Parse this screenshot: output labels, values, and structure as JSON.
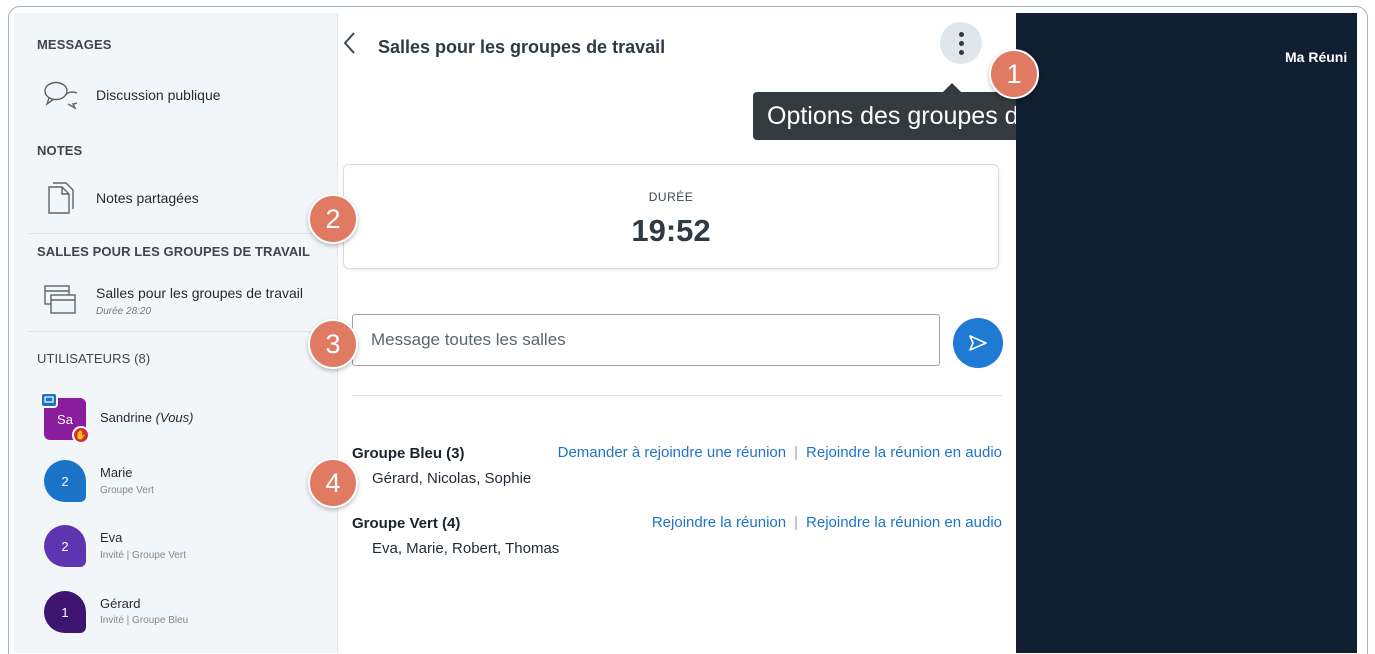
{
  "sidebar": {
    "messages_title": "MESSAGES",
    "public_chat": "Discussion publique",
    "notes_title": "NOTES",
    "shared_notes": "Notes partagées",
    "breakout_title": "SALLES POUR LES GROUPES DE TRAVAIL",
    "breakout_item": "Salles pour les groupes de travail",
    "breakout_duration": "Durée 28:20",
    "users_title": "UTILISATEURS (8)",
    "users": [
      {
        "avatar": "Sa",
        "name": "Sandrine",
        "suffix": "(Vous)",
        "meta": "",
        "color": "#8a1d9e"
      },
      {
        "avatar": "2",
        "name": "Marie",
        "suffix": "",
        "meta": "Groupe Vert",
        "color": "#1a73c9"
      },
      {
        "avatar": "2",
        "name": "Eva",
        "suffix": "",
        "meta": "Invité | Groupe Vert",
        "color": "#5e35b1"
      },
      {
        "avatar": "1",
        "name": "Gérard",
        "suffix": "",
        "meta": "Invité | Groupe Bleu",
        "color": "#3d1571"
      }
    ]
  },
  "main": {
    "title": "Salles pour les groupes de travail",
    "tooltip": "Options des groupes de travail",
    "duration_label": "DURÉE",
    "duration_value": "19:52",
    "message_placeholder": "Message toutes les salles",
    "groups": [
      {
        "name": "Groupe Bleu (3)",
        "members": "Gérard, Nicolas, Sophie",
        "link1": "Demander à rejoindre une réunion",
        "link2": "Rejoindre la réunion en audio"
      },
      {
        "name": "Groupe Vert (4)",
        "members": "Eva, Marie, Robert, Thomas",
        "link1": "Rejoindre la réunion",
        "link2": "Rejoindre la réunion en audio"
      }
    ]
  },
  "right_panel": {
    "meeting_title": "Ma Réuni"
  },
  "callouts": [
    "1",
    "2",
    "3",
    "4"
  ],
  "colors": {
    "accent": "#1f7ad4",
    "callout": "#e07a62",
    "dark_panel": "#0f1e31"
  }
}
